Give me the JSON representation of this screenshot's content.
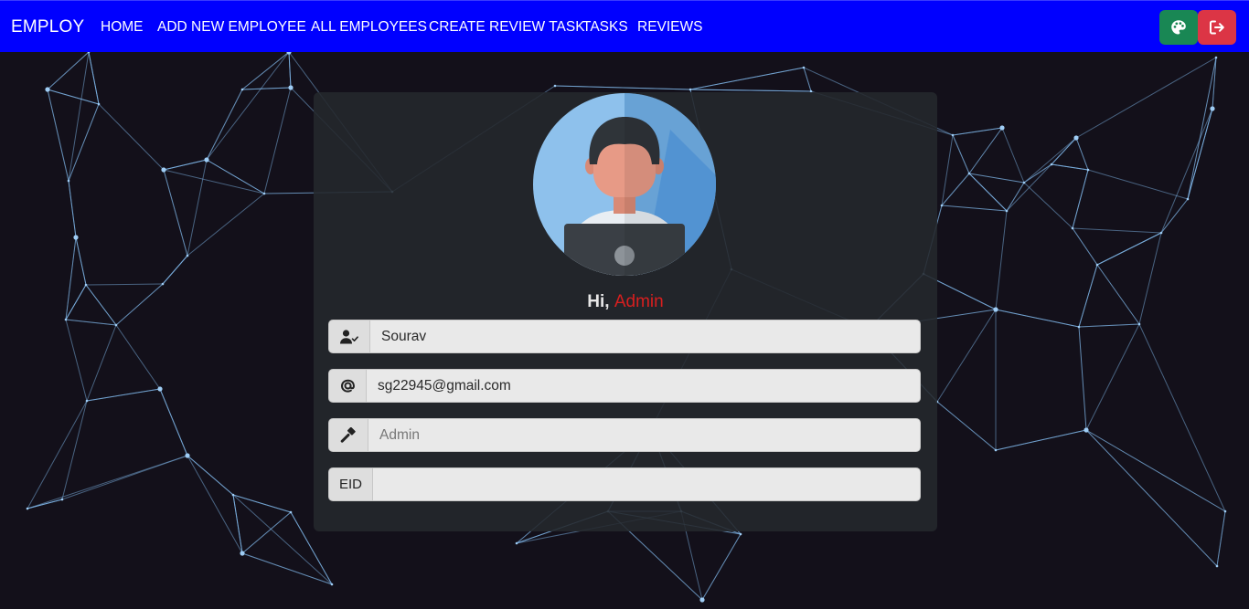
{
  "navbar": {
    "brand": "EMPLOY",
    "links": [
      {
        "label": "HOME"
      },
      {
        "label": "ADD NEW EMPLOYEE"
      },
      {
        "label": "ALL EMPLOYEES"
      },
      {
        "label": "CREATE REVIEW TASK"
      },
      {
        "label": "TASKS"
      },
      {
        "label": "REVIEWS"
      }
    ],
    "theme_button_icon": "palette-icon",
    "logout_button_icon": "sign-out-icon",
    "theme_button_color": "#198754",
    "logout_button_color": "#dc3545",
    "background_color": "#0000ff"
  },
  "profile": {
    "greeting_prefix": "Hi,",
    "role_highlight": "Admin",
    "role_highlight_color": "#d81f1f",
    "avatar_icon": "user-avatar-icon",
    "fields": {
      "name": {
        "icon": "user-check-icon",
        "value": "Sourav"
      },
      "email": {
        "icon": "at-icon",
        "value": "sg22945@gmail.com"
      },
      "role": {
        "icon": "gavel-icon",
        "placeholder": "Admin"
      },
      "eid": {
        "addon_label": "EID",
        "value": ""
      }
    }
  }
}
